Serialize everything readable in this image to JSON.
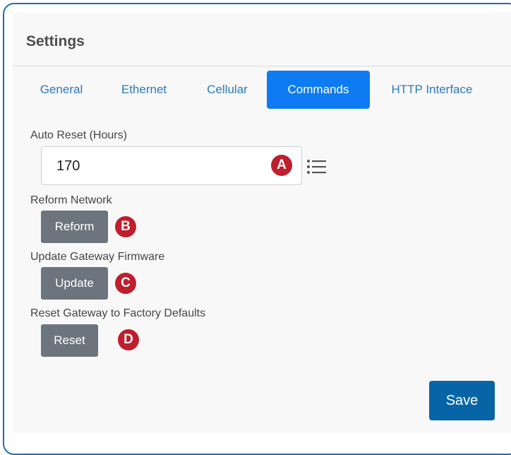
{
  "settings": {
    "title": "Settings",
    "tabs": [
      {
        "label": "General"
      },
      {
        "label": "Ethernet"
      },
      {
        "label": "Cellular"
      },
      {
        "label": "Commands"
      },
      {
        "label": "HTTP Interface"
      }
    ],
    "active_tab": "Commands",
    "auto_reset": {
      "label": "Auto Reset (Hours)",
      "value": "170",
      "marker": "A",
      "icon": "list-icon"
    },
    "reform": {
      "label": "Reform Network",
      "button": "Reform",
      "marker": "B"
    },
    "update": {
      "label": "Update Gateway Firmware",
      "button": "Update",
      "marker": "C"
    },
    "reset": {
      "label": "Reset Gateway to Factory Defaults",
      "button": "Reset",
      "marker": "D"
    },
    "save_label": "Save"
  },
  "colors": {
    "tab_active_bg": "#0f7bf2",
    "tab_text": "#2a7abf",
    "button_gray": "#6c757d",
    "save_blue": "#0765a7",
    "marker_red": "#be1e2d",
    "frame_border": "#1e6fb4"
  }
}
